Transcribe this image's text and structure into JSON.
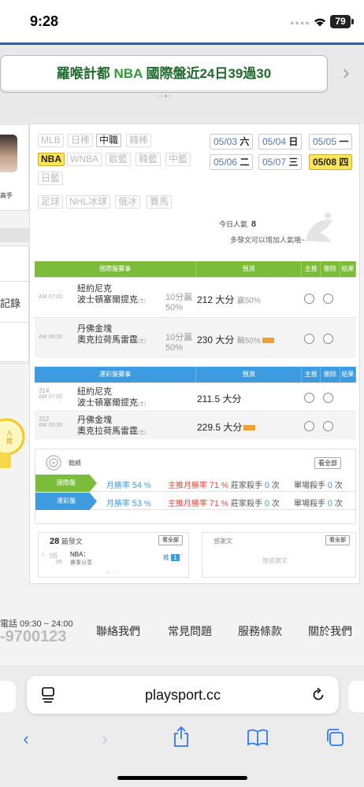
{
  "status": {
    "time": "9:28",
    "battery": "79"
  },
  "banner": {
    "prefix": "羅喉計都 ",
    "league": "NBA",
    "suffix": " 國際盤近24日39過30"
  },
  "left": {
    "expert_label": "高手",
    "record_label": "記錄",
    "lamp_text1": "入",
    "lamp_text2": "館"
  },
  "tags": {
    "row1": [
      {
        "label": "MLB",
        "state": "on"
      },
      {
        "label": "日棒",
        "state": "off"
      },
      {
        "label": "中職",
        "state": "on"
      },
      {
        "label": "韓棒",
        "state": "off"
      }
    ],
    "row2": [
      {
        "label": "NBA",
        "state": "sel"
      },
      {
        "label": "WNBA",
        "state": "off"
      },
      {
        "label": "歐籃",
        "state": "off"
      },
      {
        "label": "韓籃",
        "state": "off"
      },
      {
        "label": "中籃",
        "state": "off"
      }
    ],
    "row3": [
      {
        "label": "日籃",
        "state": "off"
      }
    ],
    "row4": [
      {
        "label": "足球",
        "state": "off"
      },
      {
        "label": "NHL冰球",
        "state": "off"
      },
      {
        "label": "俄冰",
        "state": "off"
      },
      {
        "label": "賽馬",
        "state": "off"
      }
    ]
  },
  "dates": [
    {
      "md": "05/03",
      "wd": "六",
      "sel": false
    },
    {
      "md": "05/04",
      "wd": "日",
      "sel": false
    },
    {
      "md": "05/05",
      "wd": "一",
      "sel": false
    },
    {
      "md": "05/06",
      "wd": "二",
      "sel": false
    },
    {
      "md": "05/07",
      "wd": "三",
      "sel": false
    },
    {
      "md": "05/08",
      "wd": "四",
      "sel": true
    }
  ],
  "popularity": {
    "label": "今日人氣",
    "value": "8",
    "hint": "多發文可以增加人氣哦~"
  },
  "intl": {
    "headers": {
      "match": "國際盤賽事",
      "predict": "預測",
      "main": "主推",
      "delete": "刪除",
      "result": "結果"
    },
    "rows": [
      {
        "time": "AM 07:00",
        "team1": "紐約尼克",
        "team2": "波士頓塞爾提克",
        "home": "(主)",
        "pick": "10分贏50%",
        "pred": "212 大分",
        "extra": "贏50%",
        "hot": false
      },
      {
        "time": "AM 09:30",
        "team1": "丹佛金塊",
        "team2": "奧克拉荷馬雷霆",
        "home": "(主)",
        "pick": "10分贏50%",
        "pred": "230 大分",
        "extra": "輸50%",
        "hot": true
      }
    ]
  },
  "sports": {
    "headers": {
      "match": "運彩盤賽事",
      "predict": "預測",
      "main": "主推",
      "delete": "刪除",
      "result": "結果"
    },
    "rows": [
      {
        "id": "314",
        "time": "AM 07:00",
        "team1": "紐約尼克",
        "team2": "波士頓塞爾提克",
        "home": "(主)",
        "pred": "211.5 大分",
        "hot": false
      },
      {
        "id": "312",
        "time": "AM 09:30",
        "team1": "丹佛金塊",
        "team2": "奧克拉荷馬雷霆",
        "home": "(主)",
        "pred": "229.5 大分",
        "hot": true
      }
    ]
  },
  "stats": {
    "title": "戰績",
    "view_all": "看全部",
    "rows": [
      {
        "tab": "國際盤",
        "month": "月勝率",
        "month_v": "54",
        "main": "主推月勝率",
        "main_v": "71",
        "killer": "莊家殺手",
        "killer_v": "0",
        "single": "單場殺手",
        "single_v": "0",
        "unit": "次",
        "pct": "%"
      },
      {
        "tab": "運彩盤",
        "month": "月勝率",
        "month_v": "53",
        "main": "主推月勝率",
        "main_v": "71",
        "killer": "莊家殺手",
        "killer_v": "0",
        "single": "單場殺手",
        "single_v": "0",
        "unit": "次",
        "pct": "%"
      }
    ],
    "colors": {
      "intl": "#7bbd3a",
      "sports": "#3f9be0",
      "red": "#e8483a"
    }
  },
  "posts": {
    "count": "28",
    "label": "篇發文",
    "view_all": "看全部",
    "date_m": "05",
    "date_d": "06",
    "tag": "NBA：",
    "title": "賽事分享",
    "push": "推",
    "push_n": "1"
  },
  "thanks": {
    "title": "感謝文",
    "view_all": "看全部",
    "empty": "無感謝文"
  },
  "footer": {
    "hours": "電話 09:30 ~ 24:00",
    "phone": "-9700123",
    "links": [
      "聯絡我們",
      "常見問題",
      "服務條款",
      "關於我們"
    ]
  },
  "browser": {
    "url": "playsport.cc"
  }
}
